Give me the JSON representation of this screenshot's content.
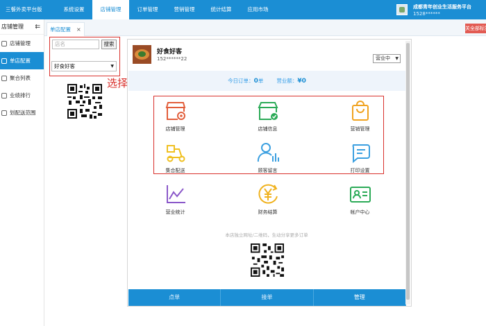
{
  "brand": "三餐外卖平台版",
  "topnav": [
    "系统设置",
    "店铺管理",
    "订单管理",
    "营销管理",
    "统计结算",
    "应用市场"
  ],
  "user": {
    "org": "成都青年创业生活服务平台",
    "id": "1528******"
  },
  "sidebar": {
    "title": "店铺管理",
    "collapse": "⇇",
    "items": [
      "店铺管理",
      "单店配置",
      "聚合列表",
      "业绩排行",
      "划配送范围"
    ]
  },
  "tab": {
    "label": "单店配置",
    "close": "×"
  },
  "close_all": "关全部标签",
  "search": {
    "placeholder": "店名",
    "button": "搜索"
  },
  "store_select": {
    "value": "好食好客",
    "arrow": "▼"
  },
  "annotation": "选择店铺",
  "store": {
    "name": "好食好客",
    "phone": "152******22",
    "status": "营业中",
    "status_arrow": "▼"
  },
  "stats": {
    "orders_label": "今日订单：",
    "orders_value": "0",
    "orders_unit": "单",
    "revenue_label": "营业额：",
    "revenue_value": "¥0"
  },
  "grid": [
    {
      "label": "店铺管理",
      "icon": "store-settings-icon"
    },
    {
      "label": "店铺信息",
      "icon": "store-info-icon"
    },
    {
      "label": "营销管理",
      "icon": "shopping-bag-icon"
    },
    {
      "label": "集合配送",
      "icon": "scooter-icon"
    },
    {
      "label": "顾客留言",
      "icon": "customer-chart-icon"
    },
    {
      "label": "打印设置",
      "icon": "print-message-icon"
    },
    {
      "label": "营业统计",
      "icon": "line-chart-icon"
    },
    {
      "label": "财务结算",
      "icon": "yuan-coin-icon"
    },
    {
      "label": "帐户中心",
      "icon": "id-card-icon"
    }
  ],
  "footnote": "本店独立网址/二维码，生动分享更多订单",
  "bottom": [
    "点单",
    "接单",
    "管理"
  ],
  "colors": {
    "primary": "#1b8ed4",
    "highlight": "#d9302b",
    "orange": "#f0a21e",
    "blue_icon": "#3a9fe0",
    "green_icon": "#2aaa56",
    "purple_icon": "#8a58c9"
  }
}
